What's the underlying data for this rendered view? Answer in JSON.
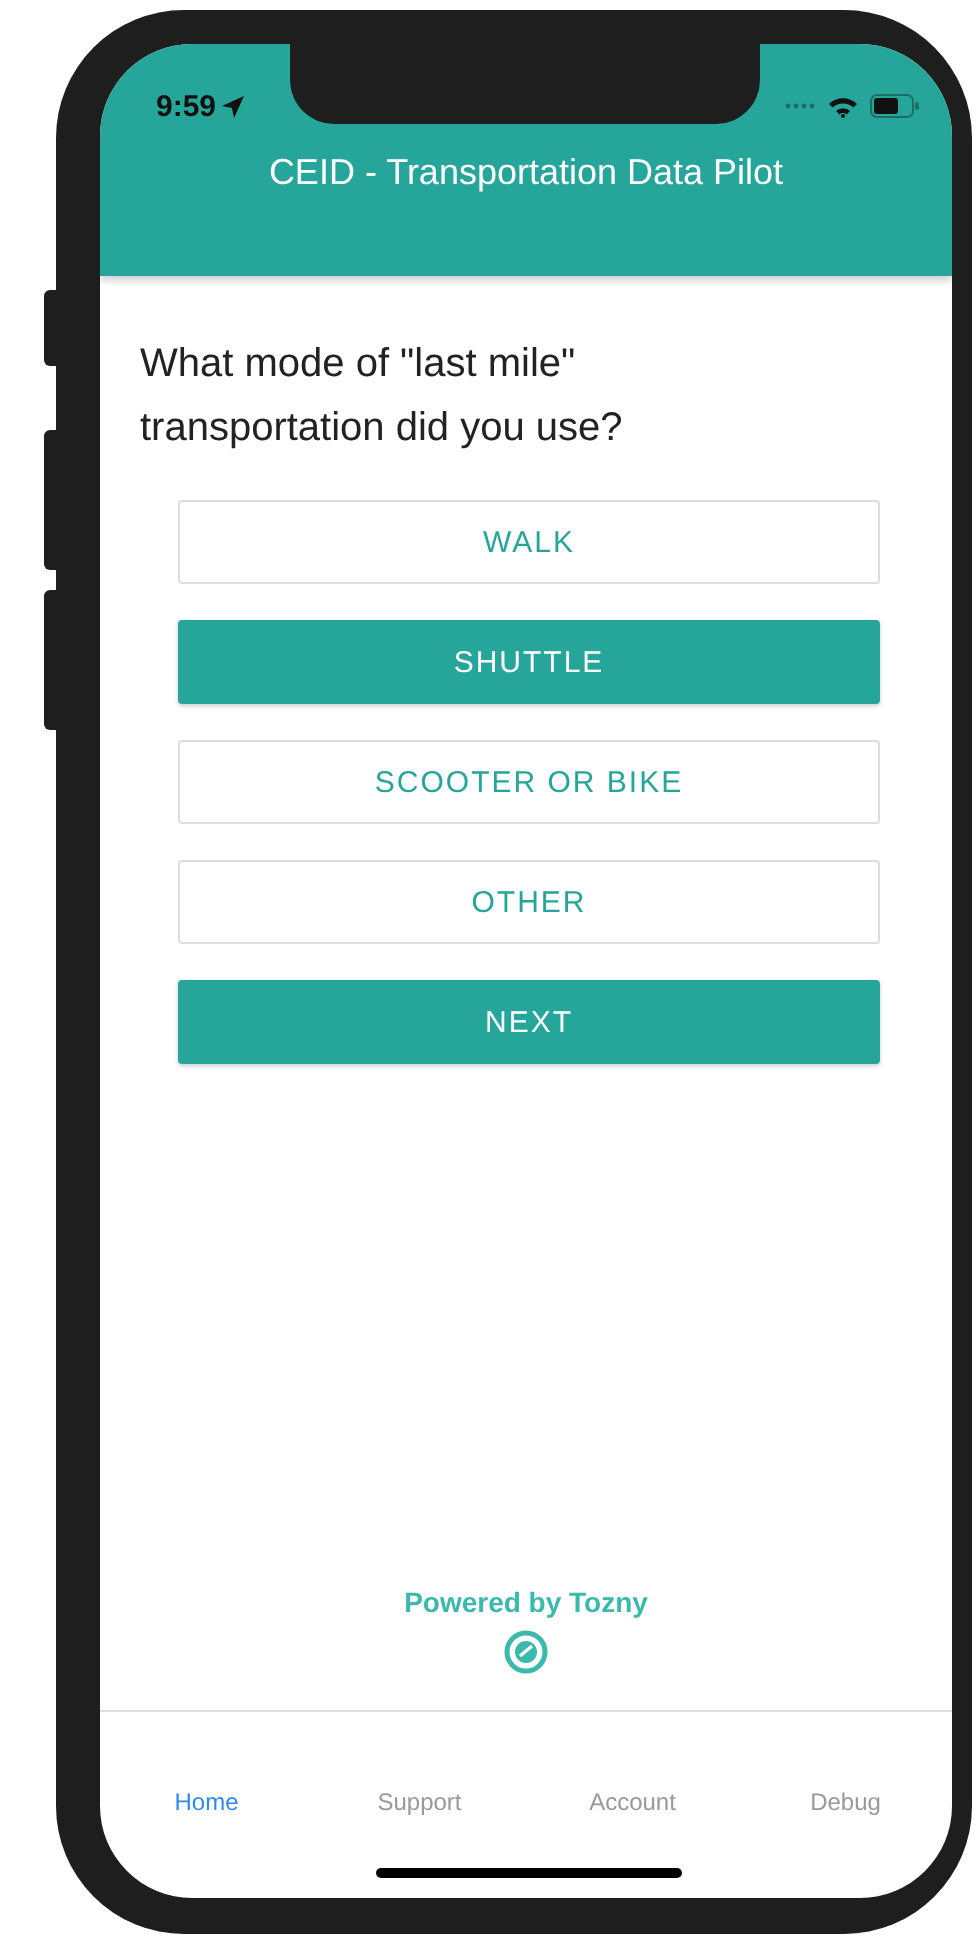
{
  "status_bar": {
    "time": "9:59"
  },
  "header": {
    "title": "CEID - Transportation Data Pilot"
  },
  "question": "What mode of \"last mile\" transportation did you use?",
  "options": [
    {
      "label": "WALK",
      "selected": false
    },
    {
      "label": "SHUTTLE",
      "selected": true
    },
    {
      "label": "SCOOTER OR BIKE",
      "selected": false
    },
    {
      "label": "OTHER",
      "selected": false
    }
  ],
  "next_button": "NEXT",
  "footer": {
    "text": "Powered by Tozny"
  },
  "tabs": [
    {
      "label": "Home",
      "selected": true
    },
    {
      "label": "Support",
      "selected": false
    },
    {
      "label": "Account",
      "selected": false
    },
    {
      "label": "Debug",
      "selected": false
    }
  ]
}
